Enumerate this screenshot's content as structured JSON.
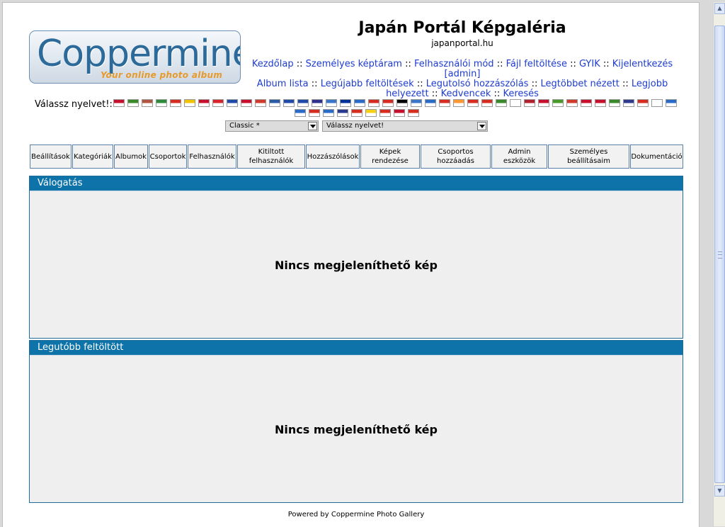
{
  "header": {
    "logo_main": "Coppermine",
    "logo_sub": "Your online photo album",
    "title": "Japán Portál Képgaléria",
    "description": "japanportal.hu"
  },
  "topnav": {
    "row1": [
      "Kezdőlap",
      "Személyes képtáram",
      "Felhasználói mód",
      "Fájl feltöltése",
      "GYIK",
      "Kijelentkezés"
    ],
    "row2": [
      "[admin]"
    ],
    "row3": [
      "Album lista",
      "Legújabb feltöltések",
      "Legutolsó hozzászólás",
      "Legtöbbet nézett",
      "Legjobb"
    ],
    "row4": [
      "helyezett",
      "Kedvencek",
      "Keresés"
    ],
    "separator": "::"
  },
  "language": {
    "label": "Válassz nyelvet!:",
    "flags_row1": [
      "#c8102e",
      "#3a8a2a",
      "#b2563f",
      "#2e8b3a",
      "#d62d20",
      "#f2c400",
      "#c8102e",
      "#d8232a",
      "#1f4aa8",
      "#c8102e",
      "#d13a2a",
      "#2a5aa8",
      "#1f4aa8",
      "#1f4aa8",
      "#2f2f8f",
      "#3a76c9",
      "#003399",
      "#2a6ac9",
      "#d62d20",
      "#d62d20",
      "#000000",
      "#3a76c9",
      "#2a6ac9",
      "#d62d20",
      "#ff9933",
      "#d62d20",
      "#d62d20",
      "#3a8a2a",
      "#ffffff",
      "#b2222e",
      "#c8102e",
      "#4a9a2a",
      "#d13a2a",
      "#c8102e",
      "#c8102e",
      "#3a8a2a",
      "#2e3a8f",
      "#d62d20",
      "#ffffff",
      "#2a6ac9"
    ],
    "flags_row2": [
      "#2a6ac9",
      "#d62d20",
      "#2a6ac9",
      "#2a3a8f",
      "#d62d20",
      "#f7d116",
      "#d62d20",
      "#c8102e",
      "#d62d20"
    ]
  },
  "selects": {
    "theme": "Classic *",
    "language": "Válassz nyelvet!"
  },
  "adminbar": [
    "Beállítások",
    "Kategóriák",
    "Albumok",
    "Csoportok",
    "Felhasználók",
    "Kitiltott felhasználók",
    "Hozzászólások",
    "Képek rendezése",
    "Csoportos hozzáadás",
    "Admin eszközök",
    "Személyes beállításaim",
    "Dokumentáció"
  ],
  "panels": {
    "featured": {
      "title": "Válogatás",
      "message": "Nincs megjeleníthető kép"
    },
    "latest": {
      "title": "Legutóbb feltöltött",
      "message": "Nincs megjeleníthető kép"
    }
  },
  "footer": "Powered by Coppermine Photo Gallery"
}
